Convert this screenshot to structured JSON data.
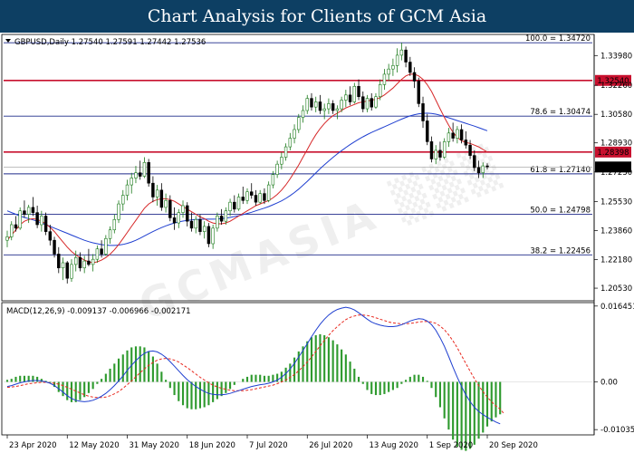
{
  "banner": {
    "title": "Chart Analysis for Clients of GCM Asia"
  },
  "colors": {
    "banner": "#0d3f63",
    "up": "#1a7a1a",
    "down": "#000000",
    "ma_fast": "#d62728",
    "ma_slow": "#1f3fd0",
    "fib_line": "#1f2a8a",
    "resistance": "#c8102e",
    "macd_line": "#1f3fd0",
    "signal_line": "#e8281e",
    "hist": "#2e9a2e",
    "price_box": "#000000"
  },
  "chart_data": [
    {
      "type": "candlestick",
      "header": "GBPUSD,Daily  1.27540 1.27591 1.27442 1.27536",
      "ylim": [
        1.198,
        1.352
      ],
      "y_ticks": [
        "1.33980",
        "1.32260",
        "1.30580",
        "1.28930",
        "1.27250",
        "1.25530",
        "1.23860",
        "1.22180",
        "1.20530"
      ],
      "x_ticks": [
        "23 Apr 2020",
        "12 May 2020",
        "31 May 2020",
        "18 Jun 2020",
        "7 Jul 2020",
        "26 Jul 2020",
        "13 Aug 2020",
        "1 Sep 2020",
        "20 Sep 2020"
      ],
      "x_tick_index": [
        0,
        14,
        28,
        42,
        56,
        70,
        84,
        98,
        112
      ],
      "fib_levels": [
        {
          "label": "100.0 = 1.34720",
          "value": 1.3472
        },
        {
          "label": "78.6 = 1.30474",
          "value": 1.30474
        },
        {
          "label": "61.8 = 1.27140",
          "value": 1.2714
        },
        {
          "label": "50.0 = 1.24798",
          "value": 1.24798
        },
        {
          "label": "38.2 = 1.22456",
          "value": 1.22456
        }
      ],
      "resistance_levels": [
        {
          "label": "1.32540",
          "value": 1.3254
        },
        {
          "label": "1.28398",
          "value": 1.28398
        }
      ],
      "current_price": {
        "label": "1.27536",
        "value": 1.27536
      },
      "candles": [
        [
          1.233,
          1.2385,
          1.229,
          1.235
        ],
        [
          1.235,
          1.244,
          1.233,
          1.242
        ],
        [
          1.242,
          1.247,
          1.238,
          1.24
        ],
        [
          1.24,
          1.252,
          1.239,
          1.25
        ],
        [
          1.25,
          1.256,
          1.246,
          1.248
        ],
        [
          1.248,
          1.2535,
          1.243,
          1.252
        ],
        [
          1.252,
          1.258,
          1.247,
          1.249
        ],
        [
          1.249,
          1.253,
          1.24,
          1.242
        ],
        [
          1.242,
          1.25,
          1.238,
          1.247
        ],
        [
          1.247,
          1.249,
          1.236,
          1.238
        ],
        [
          1.238,
          1.242,
          1.23,
          1.233
        ],
        [
          1.233,
          1.235,
          1.223,
          1.225
        ],
        [
          1.225,
          1.229,
          1.214,
          1.217
        ],
        [
          1.217,
          1.223,
          1.21,
          1.22
        ],
        [
          1.22,
          1.221,
          1.208,
          1.211
        ],
        [
          1.211,
          1.222,
          1.209,
          1.219
        ],
        [
          1.219,
          1.227,
          1.215,
          1.223
        ],
        [
          1.223,
          1.226,
          1.215,
          1.217
        ],
        [
          1.217,
          1.224,
          1.214,
          1.221
        ],
        [
          1.221,
          1.228,
          1.218,
          1.219
        ],
        [
          1.219,
          1.225,
          1.215,
          1.222
        ],
        [
          1.222,
          1.23,
          1.22,
          1.228
        ],
        [
          1.228,
          1.233,
          1.223,
          1.225
        ],
        [
          1.225,
          1.236,
          1.224,
          1.234
        ],
        [
          1.234,
          1.241,
          1.231,
          1.239
        ],
        [
          1.239,
          1.248,
          1.237,
          1.245
        ],
        [
          1.245,
          1.256,
          1.243,
          1.254
        ],
        [
          1.254,
          1.262,
          1.25,
          1.259
        ],
        [
          1.259,
          1.268,
          1.256,
          1.265
        ],
        [
          1.265,
          1.272,
          1.26,
          1.269
        ],
        [
          1.269,
          1.276,
          1.266,
          1.272
        ],
        [
          1.272,
          1.279,
          1.268,
          1.27
        ],
        [
          1.27,
          1.281,
          1.269,
          1.278
        ],
        [
          1.278,
          1.28,
          1.264,
          1.266
        ],
        [
          1.266,
          1.27,
          1.255,
          1.258
        ],
        [
          1.258,
          1.265,
          1.253,
          1.262
        ],
        [
          1.262,
          1.266,
          1.25,
          1.252
        ],
        [
          1.252,
          1.26,
          1.249,
          1.256
        ],
        [
          1.256,
          1.259,
          1.244,
          1.246
        ],
        [
          1.246,
          1.252,
          1.239,
          1.243
        ],
        [
          1.243,
          1.251,
          1.24,
          1.249
        ],
        [
          1.249,
          1.256,
          1.246,
          1.253
        ],
        [
          1.253,
          1.255,
          1.241,
          1.244
        ],
        [
          1.244,
          1.249,
          1.238,
          1.24
        ],
        [
          1.24,
          1.247,
          1.237,
          1.245
        ],
        [
          1.245,
          1.248,
          1.236,
          1.238
        ],
        [
          1.238,
          1.244,
          1.234,
          1.241
        ],
        [
          1.241,
          1.243,
          1.229,
          1.231
        ],
        [
          1.231,
          1.242,
          1.228,
          1.24
        ],
        [
          1.24,
          1.249,
          1.238,
          1.247
        ],
        [
          1.247,
          1.251,
          1.242,
          1.244
        ],
        [
          1.244,
          1.252,
          1.242,
          1.25
        ],
        [
          1.25,
          1.257,
          1.247,
          1.255
        ],
        [
          1.255,
          1.259,
          1.249,
          1.251
        ],
        [
          1.251,
          1.26,
          1.25,
          1.258
        ],
        [
          1.258,
          1.264,
          1.254,
          1.256
        ],
        [
          1.256,
          1.263,
          1.254,
          1.261
        ],
        [
          1.261,
          1.266,
          1.257,
          1.259
        ],
        [
          1.259,
          1.262,
          1.253,
          1.255
        ],
        [
          1.255,
          1.262,
          1.254,
          1.26
        ],
        [
          1.26,
          1.263,
          1.254,
          1.256
        ],
        [
          1.256,
          1.267,
          1.255,
          1.265
        ],
        [
          1.265,
          1.273,
          1.263,
          1.271
        ],
        [
          1.271,
          1.279,
          1.269,
          1.277
        ],
        [
          1.277,
          1.284,
          1.274,
          1.281
        ],
        [
          1.281,
          1.289,
          1.279,
          1.287
        ],
        [
          1.287,
          1.295,
          1.285,
          1.292
        ],
        [
          1.292,
          1.3,
          1.289,
          1.297
        ],
        [
          1.297,
          1.306,
          1.295,
          1.304
        ],
        [
          1.304,
          1.311,
          1.301,
          1.308
        ],
        [
          1.308,
          1.317,
          1.306,
          1.315
        ],
        [
          1.315,
          1.318,
          1.308,
          1.31
        ],
        [
          1.31,
          1.316,
          1.307,
          1.313
        ],
        [
          1.313,
          1.317,
          1.306,
          1.308
        ],
        [
          1.308,
          1.312,
          1.303,
          1.309
        ],
        [
          1.309,
          1.315,
          1.306,
          1.312
        ],
        [
          1.312,
          1.314,
          1.306,
          1.308
        ],
        [
          1.308,
          1.311,
          1.303,
          1.309
        ],
        [
          1.309,
          1.316,
          1.307,
          1.314
        ],
        [
          1.314,
          1.32,
          1.31,
          1.317
        ],
        [
          1.317,
          1.322,
          1.311,
          1.313
        ],
        [
          1.313,
          1.324,
          1.312,
          1.322
        ],
        [
          1.322,
          1.326,
          1.314,
          1.316
        ],
        [
          1.316,
          1.319,
          1.307,
          1.309
        ],
        [
          1.309,
          1.317,
          1.307,
          1.315
        ],
        [
          1.315,
          1.318,
          1.308,
          1.31
        ],
        [
          1.31,
          1.318,
          1.309,
          1.316
        ],
        [
          1.316,
          1.326,
          1.314,
          1.323
        ],
        [
          1.323,
          1.332,
          1.32,
          1.329
        ],
        [
          1.329,
          1.335,
          1.325,
          1.332
        ],
        [
          1.332,
          1.338,
          1.328,
          1.334
        ],
        [
          1.334,
          1.344,
          1.33,
          1.34
        ],
        [
          1.34,
          1.3472,
          1.337,
          1.343
        ],
        [
          1.343,
          1.345,
          1.333,
          1.336
        ],
        [
          1.336,
          1.339,
          1.328,
          1.33
        ],
        [
          1.33,
          1.333,
          1.321,
          1.325
        ],
        [
          1.325,
          1.327,
          1.31,
          1.312
        ],
        [
          1.312,
          1.316,
          1.298,
          1.302
        ],
        [
          1.302,
          1.306,
          1.288,
          1.29
        ],
        [
          1.29,
          1.293,
          1.278,
          1.28
        ],
        [
          1.28,
          1.288,
          1.277,
          1.285
        ],
        [
          1.285,
          1.29,
          1.279,
          1.281
        ],
        [
          1.281,
          1.292,
          1.28,
          1.29
        ],
        [
          1.29,
          1.298,
          1.287,
          1.295
        ],
        [
          1.295,
          1.301,
          1.29,
          1.292
        ],
        [
          1.292,
          1.299,
          1.289,
          1.297
        ],
        [
          1.297,
          1.3,
          1.289,
          1.291
        ],
        [
          1.291,
          1.296,
          1.286,
          1.288
        ],
        [
          1.288,
          1.291,
          1.28,
          1.282
        ],
        [
          1.282,
          1.285,
          1.273,
          1.275
        ],
        [
          1.275,
          1.279,
          1.269,
          1.272
        ],
        [
          1.272,
          1.278,
          1.269,
          1.276
        ],
        [
          1.276,
          1.2775,
          1.274,
          1.2754
        ]
      ],
      "ma_fast": [
        1.233,
        1.236,
        1.239,
        1.242,
        1.244,
        1.245,
        1.2455,
        1.245,
        1.244,
        1.2425,
        1.2405,
        1.238,
        1.235,
        1.232,
        1.229,
        1.2265,
        1.2245,
        1.223,
        1.2215,
        1.2205,
        1.22,
        1.2205,
        1.2215,
        1.223,
        1.225,
        1.2275,
        1.2305,
        1.234,
        1.2375,
        1.241,
        1.2445,
        1.248,
        1.2515,
        1.254,
        1.2555,
        1.2565,
        1.257,
        1.257,
        1.2565,
        1.2555,
        1.254,
        1.2525,
        1.251,
        1.2495,
        1.248,
        1.2465,
        1.2455,
        1.244,
        1.243,
        1.2425,
        1.2425,
        1.243,
        1.244,
        1.2455,
        1.247,
        1.2485,
        1.25,
        1.2515,
        1.253,
        1.254,
        1.255,
        1.256,
        1.2575,
        1.2595,
        1.262,
        1.265,
        1.2685,
        1.2725,
        1.2765,
        1.281,
        1.2855,
        1.29,
        1.294,
        1.2975,
        1.3005,
        1.303,
        1.305,
        1.3065,
        1.308,
        1.3095,
        1.3105,
        1.3115,
        1.3125,
        1.313,
        1.3135,
        1.314,
        1.3145,
        1.3155,
        1.317,
        1.319,
        1.321,
        1.3235,
        1.326,
        1.328,
        1.329,
        1.329,
        1.328,
        1.326,
        1.323,
        1.319,
        1.314,
        1.309,
        1.304,
        1.2995,
        1.2955,
        1.2925,
        1.2905,
        1.2895,
        1.289,
        1.288,
        1.287,
        1.2855,
        1.284
      ],
      "ma_slow": [
        1.25,
        1.249,
        1.248,
        1.247,
        1.2462,
        1.2455,
        1.2448,
        1.244,
        1.243,
        1.242,
        1.241,
        1.24,
        1.239,
        1.238,
        1.237,
        1.236,
        1.235,
        1.234,
        1.233,
        1.2322,
        1.2315,
        1.231,
        1.2305,
        1.2302,
        1.23,
        1.23,
        1.2302,
        1.2306,
        1.2312,
        1.232,
        1.233,
        1.2342,
        1.2355,
        1.2368,
        1.238,
        1.2392,
        1.2403,
        1.2413,
        1.2422,
        1.243,
        1.2436,
        1.2441,
        1.2445,
        1.2448,
        1.245,
        1.2451,
        1.2452,
        1.2452,
        1.2452,
        1.2453,
        1.2455,
        1.2458,
        1.2462,
        1.2467,
        1.2472,
        1.2478,
        1.2485,
        1.2492,
        1.25,
        1.2508,
        1.2516,
        1.2525,
        1.2535,
        1.2546,
        1.2558,
        1.2572,
        1.2588,
        1.2606,
        1.2626,
        1.2648,
        1.2671,
        1.2695,
        1.2719,
        1.2743,
        1.2766,
        1.2788,
        1.2809,
        1.2829,
        1.2848,
        1.2866,
        1.2883,
        1.2899,
        1.2914,
        1.2928,
        1.2941,
        1.2953,
        1.2964,
        1.2975,
        1.2986,
        1.2997,
        1.3008,
        1.3019,
        1.303,
        1.304,
        1.3049,
        1.3056,
        1.3061,
        1.3064,
        1.3065,
        1.3063,
        1.3059,
        1.3053,
        1.3046,
        1.3038,
        1.303,
        1.3022,
        1.3014,
        1.3006,
        1.2998,
        1.299,
        1.2981,
        1.2972,
        1.2963
      ]
    },
    {
      "type": "macd",
      "header": "MACD(12,26,9) -0.009137 -0.006966 -0.002171",
      "ylim": [
        -0.0115,
        0.0172
      ],
      "y_ticks": [
        {
          "label": "0.016451",
          "value": 0.016451
        },
        {
          "label": "0.00",
          "value": 0.0
        },
        {
          "label": "-0.010356",
          "value": -0.010356
        }
      ],
      "macd": [
        -0.001,
        -0.0008,
        -0.0005,
        -0.0002,
        0.0,
        0.0002,
        0.0003,
        0.0003,
        0.0002,
        0.0,
        -0.0003,
        -0.0008,
        -0.0015,
        -0.0022,
        -0.003,
        -0.0036,
        -0.004,
        -0.0042,
        -0.0043,
        -0.0042,
        -0.004,
        -0.0036,
        -0.0031,
        -0.0025,
        -0.0017,
        -0.0008,
        0.0002,
        0.0013,
        0.0025,
        0.0036,
        0.0046,
        0.0055,
        0.0062,
        0.0066,
        0.0067,
        0.0065,
        0.006,
        0.0053,
        0.0044,
        0.0034,
        0.0024,
        0.0014,
        0.0005,
        -0.0003,
        -0.001,
        -0.0016,
        -0.0021,
        -0.0025,
        -0.0027,
        -0.0028,
        -0.0028,
        -0.0027,
        -0.0025,
        -0.0022,
        -0.0019,
        -0.0016,
        -0.0013,
        -0.001,
        -0.0008,
        -0.0006,
        -0.0005,
        -0.0003,
        0.0,
        0.0004,
        0.001,
        0.0018,
        0.0028,
        0.004,
        0.0054,
        0.0068,
        0.0083,
        0.0098,
        0.0112,
        0.0125,
        0.0136,
        0.0145,
        0.0152,
        0.0157,
        0.016,
        0.0162,
        0.016,
        0.0156,
        0.015,
        0.0143,
        0.0136,
        0.013,
        0.0126,
        0.0123,
        0.0121,
        0.012,
        0.012,
        0.0121,
        0.0124,
        0.0128,
        0.0132,
        0.0135,
        0.0137,
        0.0136,
        0.0132,
        0.0124,
        0.0112,
        0.0096,
        0.0077,
        0.0055,
        0.0032,
        0.001,
        -0.001,
        -0.0028,
        -0.0043,
        -0.0055,
        -0.0064,
        -0.0071,
        -0.0077,
        -0.0082,
        -0.0087,
        -0.0091
      ],
      "signal": [
        -0.0012,
        -0.0011,
        -0.001,
        -0.0008,
        -0.0006,
        -0.0004,
        -0.0003,
        -0.0002,
        -0.0001,
        -0.0001,
        -0.0002,
        -0.0003,
        -0.0005,
        -0.0008,
        -0.0012,
        -0.0016,
        -0.002,
        -0.0024,
        -0.0028,
        -0.0031,
        -0.0033,
        -0.0034,
        -0.0034,
        -0.0033,
        -0.003,
        -0.0026,
        -0.0021,
        -0.0014,
        -0.0006,
        0.0002,
        0.0011,
        0.002,
        0.0028,
        0.0036,
        0.0042,
        0.0047,
        0.005,
        0.0051,
        0.005,
        0.0047,
        0.0043,
        0.0037,
        0.0031,
        0.0024,
        0.0017,
        0.001,
        0.0004,
        -0.0002,
        -0.0007,
        -0.0011,
        -0.0014,
        -0.0016,
        -0.0018,
        -0.0019,
        -0.0019,
        -0.0019,
        -0.0018,
        -0.0017,
        -0.0015,
        -0.0013,
        -0.0011,
        -0.0009,
        -0.0007,
        -0.0004,
        0.0,
        0.0004,
        0.001,
        0.0016,
        0.0024,
        0.0033,
        0.0043,
        0.0054,
        0.0066,
        0.0078,
        0.009,
        0.0101,
        0.0111,
        0.012,
        0.0128,
        0.0135,
        0.014,
        0.0143,
        0.0145,
        0.0145,
        0.0144,
        0.0142,
        0.0139,
        0.0136,
        0.0133,
        0.013,
        0.0128,
        0.0127,
        0.0126,
        0.0126,
        0.0127,
        0.0128,
        0.013,
        0.0131,
        0.0131,
        0.013,
        0.0127,
        0.0121,
        0.0113,
        0.0102,
        0.0089,
        0.0074,
        0.0057,
        0.004,
        0.0023,
        0.0007,
        -0.0008,
        -0.0021,
        -0.0033,
        -0.0043,
        -0.0052,
        -0.0059,
        -0.007
      ]
    }
  ]
}
